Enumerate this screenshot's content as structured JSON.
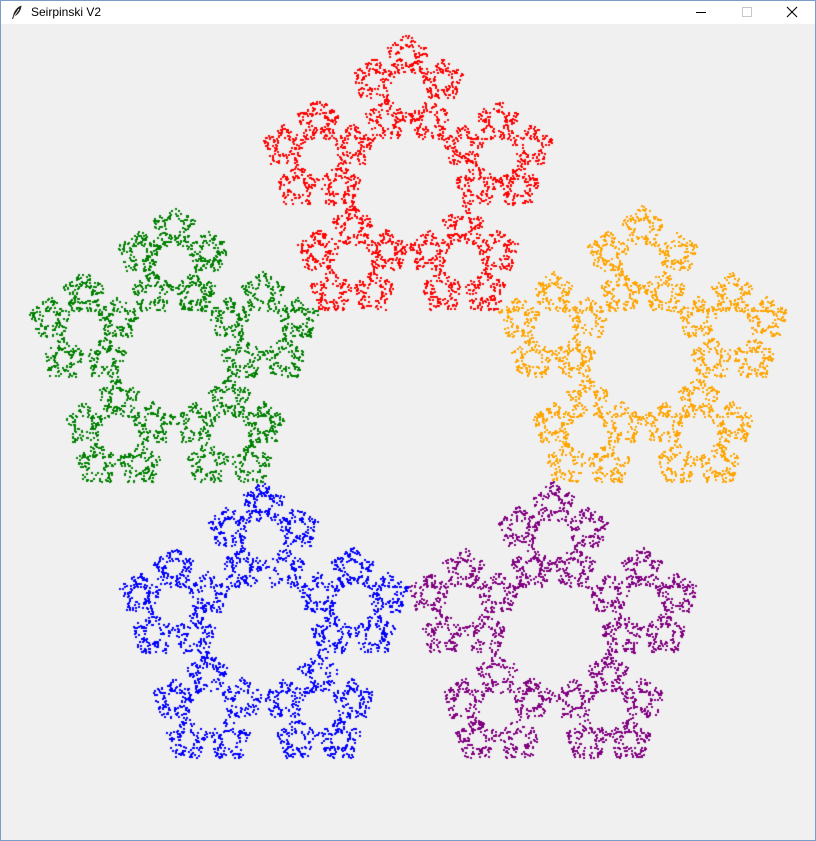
{
  "window": {
    "title": "Seirpinski V2",
    "controls": {
      "minimize_icon": "minimize-icon",
      "maximize_icon": "maximize-icon",
      "close_icon": "close-icon"
    },
    "app_icon": "feather-icon"
  },
  "canvas": {
    "background": "#f0f0f0",
    "region_colors": [
      "#ff0000",
      "#ffa500",
      "#800080",
      "#0000ff",
      "#008000"
    ]
  }
}
